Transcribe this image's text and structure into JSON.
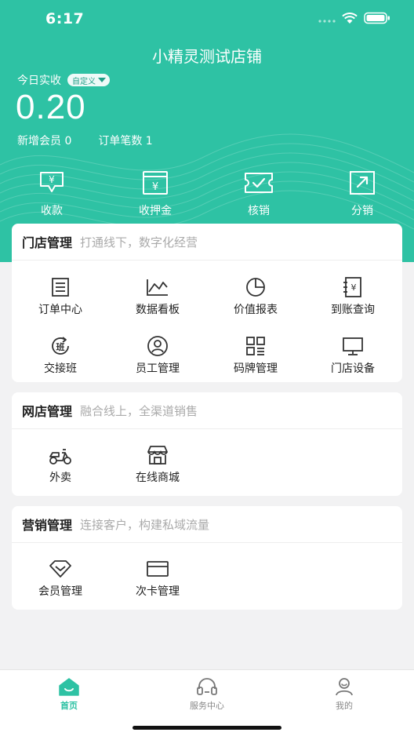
{
  "status_bar": {
    "time": "6:17"
  },
  "header": {
    "store_name": "小精灵测试店铺",
    "today_label": "今日实收",
    "custom_label": "自定义",
    "amount": "0.20",
    "new_members": "新增会员 0",
    "order_count": "订单笔数 1"
  },
  "quick_actions": [
    {
      "label": "收款",
      "icon": "receive-payment-icon"
    },
    {
      "label": "收押金",
      "icon": "deposit-icon"
    },
    {
      "label": "核销",
      "icon": "verify-ticket-icon"
    },
    {
      "label": "分销",
      "icon": "distribution-icon"
    }
  ],
  "store_mgmt": {
    "title": "门店管理",
    "subtitle": "打通线下，数字化经营",
    "items": [
      {
        "label": "订单中心",
        "icon": "order-list-icon"
      },
      {
        "label": "数据看板",
        "icon": "line-chart-icon"
      },
      {
        "label": "价值报表",
        "icon": "pie-chart-icon"
      },
      {
        "label": "到账查询",
        "icon": "ledger-icon"
      },
      {
        "label": "交接班",
        "icon": "shift-icon"
      },
      {
        "label": "员工管理",
        "icon": "staff-icon"
      },
      {
        "label": "码牌管理",
        "icon": "qr-code-icon"
      },
      {
        "label": "门店设备",
        "icon": "monitor-icon"
      }
    ]
  },
  "online_mgmt": {
    "title": "网店管理",
    "subtitle": "融合线上，全渠道销售",
    "items": [
      {
        "label": "外卖",
        "icon": "scooter-icon"
      },
      {
        "label": "在线商城",
        "icon": "shop-icon"
      }
    ]
  },
  "marketing_mgmt": {
    "title": "营销管理",
    "subtitle": "连接客户，构建私域流量",
    "items": [
      {
        "label": "会员管理",
        "icon": "diamond-icon"
      },
      {
        "label": "次卡管理",
        "icon": "card-icon"
      }
    ]
  },
  "tabbar": [
    {
      "label": "首页",
      "icon": "home-icon",
      "active": true
    },
    {
      "label": "服务中心",
      "icon": "headset-icon",
      "active": false
    },
    {
      "label": "我的",
      "icon": "user-icon",
      "active": false
    }
  ],
  "colors": {
    "brand": "#2ec2a4",
    "active_tab": "#2ec2a4",
    "subtitle": "#aaaaaa"
  }
}
